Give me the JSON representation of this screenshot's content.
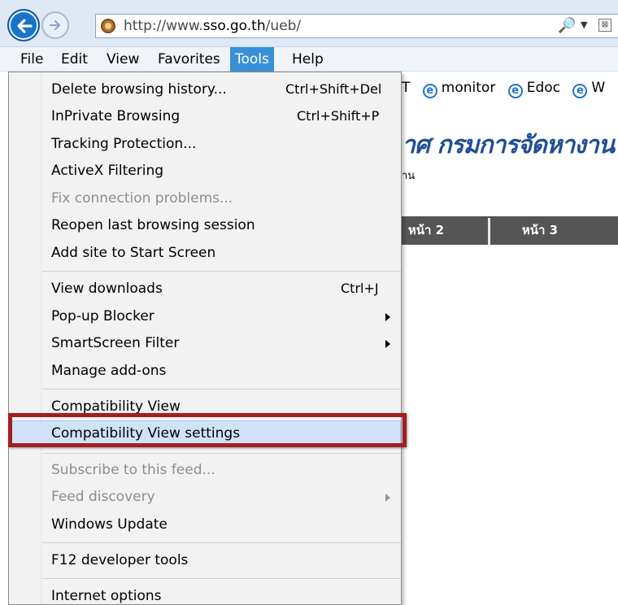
{
  "browser": {
    "url_prefix": "http://www.",
    "url_domain": "sso.go.th",
    "url_suffix": "/ueb/",
    "search_icon": "🔎",
    "caret_icon": "▼",
    "compat_icon": "⊠"
  },
  "menubar": {
    "items": [
      "File",
      "Edit",
      "View",
      "Favorites",
      "Tools",
      "Help"
    ]
  },
  "favorites_bar": {
    "items": [
      "T",
      "monitor",
      "Edoc",
      "W"
    ]
  },
  "page": {
    "title": "าศ กรมการจัดหางาน",
    "subtitle": "าน",
    "tabs": [
      "หน้า 2",
      "หน้า 3"
    ]
  },
  "tools_menu": {
    "items": [
      {
        "label": "Delete browsing history...",
        "shortcut": "Ctrl+Shift+Del"
      },
      {
        "label": "InPrivate Browsing",
        "shortcut": "Ctrl+Shift+P"
      },
      {
        "label": "Tracking Protection..."
      },
      {
        "label": "ActiveX Filtering"
      },
      {
        "label": "Fix connection problems...",
        "disabled": true
      },
      {
        "label": "Reopen last browsing session"
      },
      {
        "label": "Add site to Start Screen"
      },
      {
        "label": "View downloads",
        "shortcut": "Ctrl+J"
      },
      {
        "label": "Pop-up Blocker",
        "submenu": true
      },
      {
        "label": "SmartScreen Filter",
        "submenu": true
      },
      {
        "label": "Manage add-ons"
      },
      {
        "label": "Compatibility View"
      },
      {
        "label": "Compatibility View settings",
        "selected": true
      },
      {
        "label": "Subscribe to this feed...",
        "disabled": true
      },
      {
        "label": "Feed discovery",
        "disabled": true,
        "submenu": true
      },
      {
        "label": "Windows Update"
      },
      {
        "label": "F12 developer tools"
      },
      {
        "label": "Internet options"
      }
    ]
  },
  "colors": {
    "highlight_border": "#a01e23",
    "selected_item": "#cfe2f7",
    "menubar_active": "#3a8fd8",
    "page_title": "#1f4f96"
  }
}
